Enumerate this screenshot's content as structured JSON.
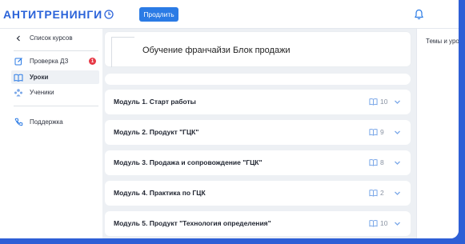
{
  "header": {
    "logo": "АНТИТРЕНИНГИ",
    "extend_label": "Продлить"
  },
  "sidebar": {
    "back_label": "Список курсов",
    "items": [
      {
        "label": "Проверка ДЗ",
        "badge": "1",
        "icon": "edit-icon"
      },
      {
        "label": "Уроки",
        "icon": "book-icon",
        "active": true
      },
      {
        "label": "Ученики",
        "icon": "users-icon"
      },
      {
        "label": "Поддержка",
        "icon": "phone-icon"
      }
    ]
  },
  "course": {
    "title": "Обучение франчайзи Блок продажи"
  },
  "modules": [
    {
      "title": "Модуль 1. Старт работы",
      "count": "10"
    },
    {
      "title": "Модуль 2. Продукт \"ГЦК\"",
      "count": "9"
    },
    {
      "title": "Модуль 3. Продажа и сопровождение \"ГЦК\"",
      "count": "8"
    },
    {
      "title": "Модуль 4. Практика по ГЦК",
      "count": "2"
    },
    {
      "title": "Модуль 5. Продукт \"Технология определения\"",
      "count": "10"
    }
  ],
  "right_panel": {
    "topics_label": "Темы и уроки"
  },
  "colors": {
    "accent": "#2b7be5",
    "brand": "#2b63d9",
    "badge": "#e63946",
    "background": "#edf0f4",
    "frame": "#2e5fd6"
  }
}
